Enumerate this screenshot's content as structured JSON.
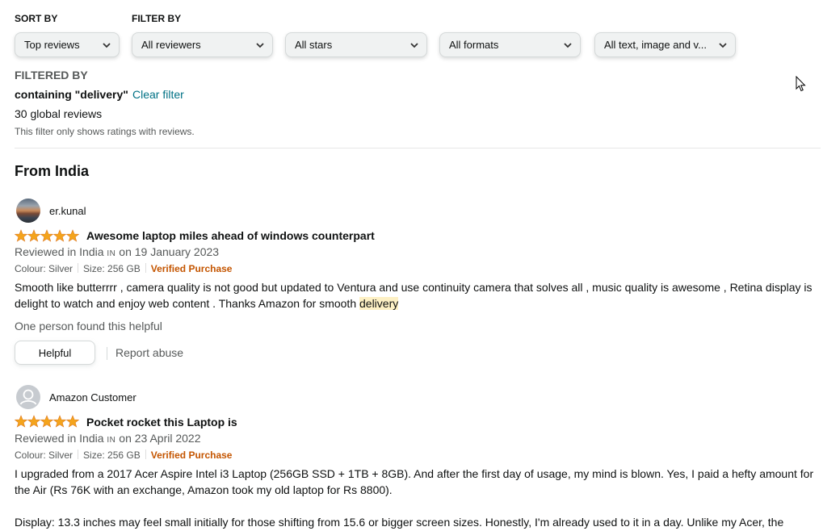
{
  "sort": {
    "label": "SORT BY",
    "value": "Top reviews"
  },
  "filter": {
    "label": "FILTER BY",
    "reviewers": "All reviewers",
    "stars": "All stars",
    "formats": "All formats",
    "media": "All text, image and v..."
  },
  "filtered": {
    "heading": "FILTERED BY",
    "containing": "containing \"delivery\"",
    "clear": "Clear filter",
    "count": "30 global reviews",
    "note": "This filter only shows ratings with reviews."
  },
  "section_title": "From India",
  "colors": {
    "link": "#007185",
    "verified": "#c45500",
    "star": "#f4a41c",
    "highlight": "#fdf0c4"
  },
  "reviews": [
    {
      "user": "er.kunal",
      "avatar": "photo-avatar",
      "rating": 5,
      "title": "Awesome laptop miles ahead of windows counterpart",
      "reviewed_prefix": "Reviewed in India ",
      "country_code": "IN",
      "reviewed_suffix": " on 19 January 2023",
      "colour": "Colour: Silver",
      "size": "Size: 256 GB",
      "verified": "Verified Purchase",
      "body_before": "Smooth like butterrrr , camera quality is not good but updated to Ventura and use continuity camera that solves all , music quality is awesome , Retina display is delight to watch and enjoy web content . Thanks Amazon for smooth ",
      "body_highlight": "delivery",
      "helpful_count": "One person found this helpful",
      "helpful_btn": "Helpful",
      "report": "Report abuse"
    },
    {
      "user": "Amazon Customer",
      "avatar": "default-user-icon",
      "rating": 5,
      "title": "Pocket rocket this Laptop is",
      "reviewed_prefix": "Reviewed in India ",
      "country_code": "IN",
      "reviewed_suffix": " on 23 April 2022",
      "colour": "Colour: Silver",
      "size": "Size: 256 GB",
      "verified": "Verified Purchase",
      "body_p1": "I upgraded from a 2017 Acer Aspire Intel i3 Laptop (256GB SSD + 1TB + 8GB). And after the first day of usage, my mind is blown. Yes, I paid a hefty amount for the Air (Rs 76K with an exchange, Amazon took my old laptop for Rs 8800).",
      "body_p2": "Display: 13.3 inches may feel small initially for those shifting from 15.6 or bigger screen sizes. Honestly, I'm already used to it in a day. Unlike my Acer, the"
    }
  ]
}
